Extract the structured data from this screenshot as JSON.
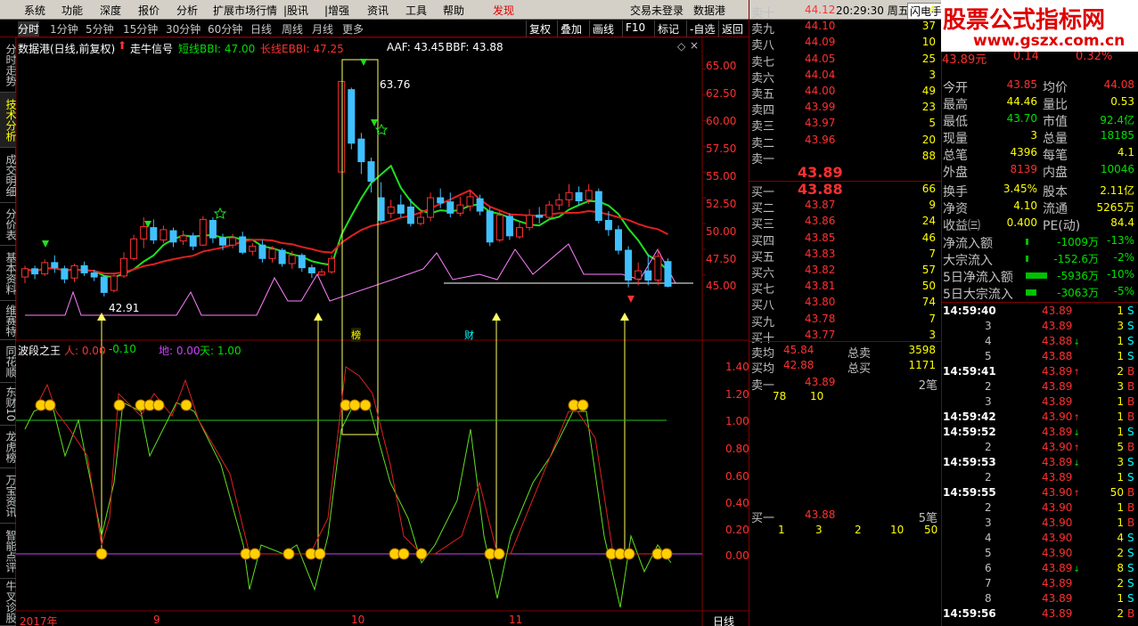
{
  "menu": [
    "系统",
    "功能",
    "深度",
    "报价",
    "分析",
    "扩展市场行情",
    "|股讯",
    "|增强",
    "资讯",
    "工具",
    "帮助",
    "发现"
  ],
  "menu_status": "交易未登录",
  "menu_stock": "数据港",
  "clock": "20:29:30 周五",
  "flash_btn": "闪电手",
  "logo": {
    "title": "股票公式指标网",
    "url": "www.gszx.com.cn"
  },
  "periods": [
    "分时",
    "1分钟",
    "5分钟",
    "15分钟",
    "30分钟",
    "60分钟",
    "日线",
    "周线",
    "月线",
    "更多"
  ],
  "tools": [
    "复权",
    "叠加",
    "画线",
    "F10",
    "标记",
    "-自选",
    "返回"
  ],
  "left_tabs": [
    "分时走势",
    "技术分析",
    "成交明细",
    "分价表",
    "基本资料",
    "维赛特",
    "同花顺",
    "东财10",
    "龙虎榜",
    "万宝资讯",
    "智能点评",
    "牛叉诊股"
  ],
  "main_panel": {
    "title": "数据港(日线,前复权)",
    "signal": "走牛信号",
    "bbi_short": "短线BBI: 47.00",
    "bbi_long": "长线EBBI: 47.25",
    "aaf": "AAF: 43.45",
    "bbf": "BBF: 43.88",
    "price_labels": [
      "65.00",
      "62.50",
      "60.00",
      "57.50",
      "55.00",
      "52.50",
      "50.00",
      "47.50",
      "45.00"
    ],
    "high_mark": "63.76",
    "low_mark": "42.91",
    "tag_bang": "榜",
    "tag_cai": "财"
  },
  "sub_panel": {
    "title": "波段之王",
    "ren": "人: 0.00",
    "ren2": ": -0.10",
    "di": "地: 0.00",
    "tian": "天: 1.00",
    "labels": [
      "1.40",
      "1.20",
      "1.00",
      "0.80",
      "0.60",
      "0.40",
      "0.20",
      "0.00"
    ]
  },
  "x_axis": {
    "labels": [
      "2017年",
      "9",
      "10",
      "11"
    ],
    "period_btn": "日线"
  },
  "chart_data": {
    "type": "candlestick",
    "ylim": [
      42,
      66
    ],
    "candles": [
      [
        44.8,
        45.6,
        44.2,
        45.9
      ],
      [
        45.6,
        45.1,
        44.6,
        45.9
      ],
      [
        45.1,
        46.2,
        44.9,
        46.5
      ],
      [
        46.2,
        45.7,
        45.2,
        46.9
      ],
      [
        45.6,
        44.6,
        44.2,
        45.9
      ],
      [
        44.7,
        45.9,
        44.3,
        46.1
      ],
      [
        45.9,
        45.2,
        44.9,
        46.3
      ],
      [
        45.2,
        44.8,
        44.4,
        45.5
      ],
      [
        44.8,
        43.3,
        42.9,
        45.0
      ],
      [
        43.5,
        44.9,
        43.3,
        45.2
      ],
      [
        44.9,
        46.6,
        44.7,
        47.2
      ],
      [
        46.6,
        48.5,
        46.4,
        48.9
      ],
      [
        48.5,
        49.7,
        47.6,
        50.6
      ],
      [
        49.6,
        48.4,
        48.0,
        50.4
      ],
      [
        48.4,
        49.4,
        48.1,
        49.8
      ],
      [
        49.3,
        48.2,
        47.7,
        49.6
      ],
      [
        48.3,
        48.8,
        47.9,
        49.3
      ],
      [
        48.8,
        47.8,
        47.4,
        49.1
      ],
      [
        47.9,
        50.4,
        47.8,
        50.7
      ],
      [
        50.3,
        48.6,
        48.1,
        50.6
      ],
      [
        48.6,
        47.9,
        47.4,
        49.0
      ],
      [
        47.9,
        48.6,
        47.6,
        49.0
      ],
      [
        48.7,
        47.2,
        47.0,
        49.2
      ],
      [
        47.3,
        47.8,
        46.9,
        48.1
      ],
      [
        47.9,
        46.6,
        46.2,
        48.4
      ],
      [
        46.6,
        47.5,
        46.2,
        47.8
      ],
      [
        47.4,
        46.1,
        45.8,
        47.6
      ],
      [
        46.1,
        46.9,
        45.6,
        47.3
      ],
      [
        46.9,
        45.7,
        45.3,
        47.1
      ],
      [
        45.7,
        45.2,
        44.7,
        46.0
      ],
      [
        45.0,
        45.3,
        44.9,
        45.6
      ],
      [
        45.3,
        46.6,
        45.1,
        46.9
      ],
      [
        55.0,
        63.8,
        55.0,
        63.8
      ],
      [
        63.0,
        57.8,
        57.2,
        63.2
      ],
      [
        58.2,
        56.0,
        54.8,
        58.8
      ],
      [
        56.0,
        54.1,
        53.0,
        56.4
      ],
      [
        52.5,
        50.3,
        50.1,
        54.0
      ],
      [
        51.0,
        51.6,
        50.5,
        52.3
      ],
      [
        51.8,
        51.0,
        50.6,
        52.8
      ],
      [
        51.6,
        50.0,
        49.7,
        52.4
      ],
      [
        50.0,
        50.6,
        49.8,
        51.4
      ],
      [
        50.6,
        52.5,
        50.2,
        53.0
      ],
      [
        52.5,
        52.0,
        51.5,
        53.4
      ],
      [
        52.1,
        51.0,
        50.6,
        53.0
      ],
      [
        51.0,
        51.8,
        50.7,
        52.6
      ],
      [
        51.7,
        52.6,
        51.2,
        53.2
      ],
      [
        52.4,
        51.2,
        50.8,
        52.8
      ],
      [
        51.2,
        48.2,
        47.8,
        51.6
      ],
      [
        48.4,
        50.8,
        48.2,
        51.2
      ],
      [
        50.7,
        48.8,
        48.4,
        51.0
      ],
      [
        48.7,
        49.6,
        48.5,
        50.1
      ],
      [
        49.6,
        50.8,
        49.3,
        51.4
      ],
      [
        50.8,
        50.6,
        50.0,
        51.6
      ],
      [
        50.6,
        51.8,
        50.4,
        52.2
      ],
      [
        51.8,
        52.3,
        51.3,
        52.9
      ],
      [
        52.3,
        53.0,
        51.6,
        53.8
      ],
      [
        53.0,
        52.2,
        51.8,
        53.6
      ],
      [
        52.3,
        53.2,
        51.9,
        53.8
      ],
      [
        53.1,
        50.3,
        50.0,
        53.4
      ],
      [
        50.3,
        49.4,
        48.8,
        51.2
      ],
      [
        49.4,
        47.4,
        47.0,
        49.8
      ],
      [
        47.4,
        44.5,
        43.8,
        47.8
      ],
      [
        44.6,
        45.4,
        44.0,
        46.2
      ],
      [
        45.4,
        44.5,
        44.0,
        47.0
      ],
      [
        44.5,
        46.8,
        44.0,
        47.5
      ],
      [
        46.3,
        43.9,
        43.8,
        46.6
      ]
    ]
  }
}
